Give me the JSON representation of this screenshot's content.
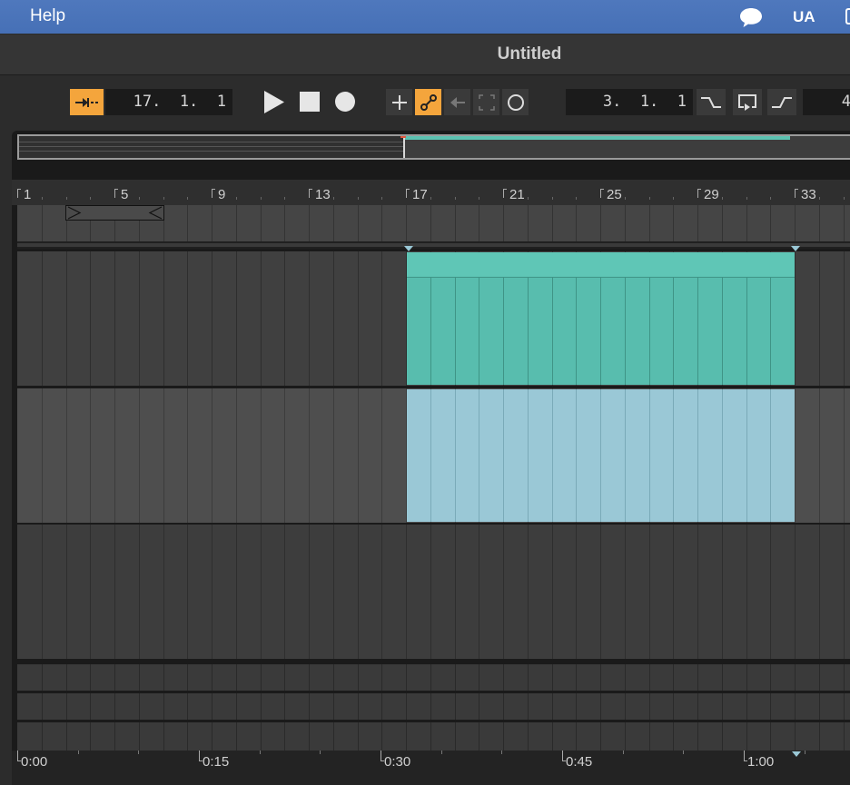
{
  "menubar": {
    "help_label": "Help",
    "user_initials": "UA",
    "icons": [
      "chat-bubble-icon",
      "window-edge-icon"
    ]
  },
  "window": {
    "title": "Untitled"
  },
  "transport": {
    "follow_icon": "follow-arrow-icon",
    "position": "17.  1.  1",
    "play_icon": "play-icon",
    "stop_icon": "stop-icon",
    "record_icon": "record-icon",
    "tools": [
      "add-icon",
      "automation-curve-icon",
      "back-arrow-icon",
      "capture-icon",
      "loop-circle-icon"
    ],
    "loop_start": "3.  1.  1",
    "loop_tools": [
      "punch-in-icon",
      "loop-icon",
      "punch-out-icon"
    ],
    "loop_length_partial": "4",
    "accent_color": "#f4a53c"
  },
  "ruler": {
    "bar_labels": [
      "1",
      "5",
      "9",
      "13",
      "17",
      "21",
      "25",
      "29",
      "33"
    ]
  },
  "time_ruler": {
    "time_labels": [
      "0:00",
      "0:15",
      "0:30",
      "0:45",
      "1:00"
    ]
  },
  "tracks": {
    "clip_colors": {
      "teal": "#58bdae",
      "light_blue": "#9ac8d6"
    },
    "clip_start_bar": 17,
    "clip_end_bar": 33
  }
}
